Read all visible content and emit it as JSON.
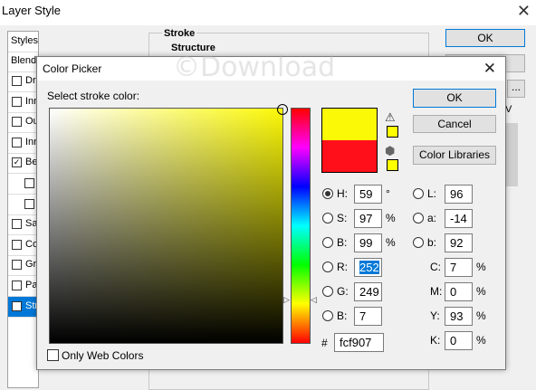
{
  "layer_style": {
    "title": "Layer Style",
    "close_glyph": "✕",
    "styles_header": "Styles",
    "blending_label": "Blendi",
    "style_rows": [
      {
        "label": "Dro",
        "checked": false
      },
      {
        "label": "Inn",
        "checked": false
      },
      {
        "label": "Ou",
        "checked": false
      },
      {
        "label": "Inn",
        "checked": false
      },
      {
        "label": "Be",
        "checked": true
      },
      {
        "label": "",
        "checked": false
      },
      {
        "label": "",
        "checked": false
      },
      {
        "label": "Sat",
        "checked": false
      },
      {
        "label": "Co",
        "checked": false
      },
      {
        "label": "Gra",
        "checked": false
      },
      {
        "label": "Pat",
        "checked": false
      },
      {
        "label": "Str",
        "checked": true,
        "selected": true
      }
    ],
    "stroke_legend": "Stroke",
    "structure_legend": "Structure",
    "ok_label": "OK",
    "dots_label": "...",
    "v_label": "V"
  },
  "color_picker": {
    "title": "Color Picker",
    "close_glyph": "✕",
    "watermark": "©Download",
    "prompt": "Select stroke color:",
    "ok_label": "OK",
    "cancel_label": "Cancel",
    "libraries_label": "Color Libraries",
    "new_color": "#fcf907",
    "current_color": "#ff0f1a",
    "gamut_swatch_color": "#ffff00",
    "cube_swatch_color": "#ffff00",
    "hsb": [
      {
        "label": "H:",
        "value": "59",
        "unit": "°",
        "selected": true
      },
      {
        "label": "S:",
        "value": "97",
        "unit": "%",
        "selected": false
      },
      {
        "label": "B:",
        "value": "99",
        "unit": "%",
        "selected": false
      }
    ],
    "rgb": [
      {
        "label": "R:",
        "value": "252",
        "highlighted": true
      },
      {
        "label": "G:",
        "value": "249",
        "highlighted": false
      },
      {
        "label": "B:",
        "value": "7",
        "highlighted": false
      }
    ],
    "lab": [
      {
        "label": "L:",
        "value": "96"
      },
      {
        "label": "a:",
        "value": "-14"
      },
      {
        "label": "b:",
        "value": "92"
      }
    ],
    "cmyk": [
      {
        "label": "C:",
        "value": "7",
        "unit": "%"
      },
      {
        "label": "M:",
        "value": "0",
        "unit": "%"
      },
      {
        "label": "Y:",
        "value": "93",
        "unit": "%"
      },
      {
        "label": "K:",
        "value": "0",
        "unit": "%"
      }
    ],
    "hex_hash": "#",
    "hex_value": "fcf907",
    "only_web_colors_label": "Only Web Colors",
    "warning_icon": "warning-triangle-icon",
    "cube_icon": "web-safe-cube-icon"
  }
}
